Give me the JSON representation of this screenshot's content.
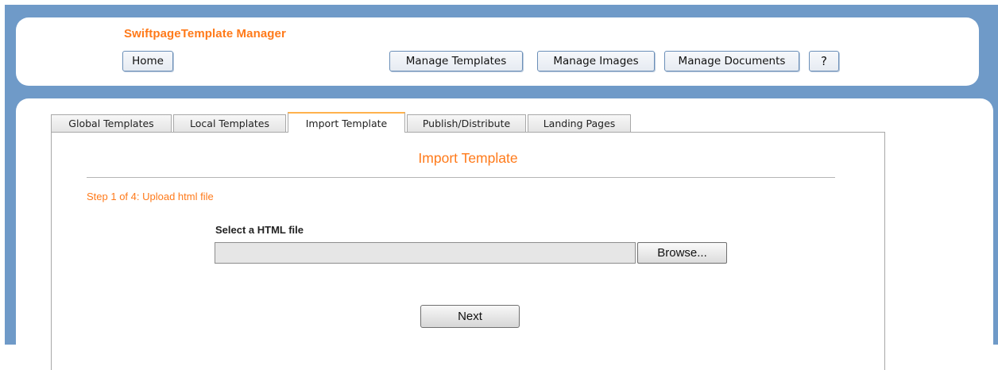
{
  "header": {
    "app_title": "SwiftpageTemplate Manager",
    "nav": {
      "home": "Home",
      "manage_templates": "Manage Templates",
      "manage_images": "Manage Images",
      "manage_documents": "Manage Documents",
      "help": "?"
    }
  },
  "tabs": [
    {
      "label": "Global Templates",
      "active": false
    },
    {
      "label": "Local Templates",
      "active": false
    },
    {
      "label": "Import Template",
      "active": true
    },
    {
      "label": "Publish/Distribute",
      "active": false
    },
    {
      "label": "Landing Pages",
      "active": false
    }
  ],
  "main": {
    "section_title": "Import Template",
    "step_text": "Step 1 of 4: Upload html file",
    "file_label": "Select a HTML file",
    "file_value": "",
    "browse_label": "Browse...",
    "next_label": "Next"
  },
  "colors": {
    "accent_orange": "#ff7a1a",
    "frame_blue": "#6f9ac8",
    "active_tab_border": "#ffb24d"
  }
}
